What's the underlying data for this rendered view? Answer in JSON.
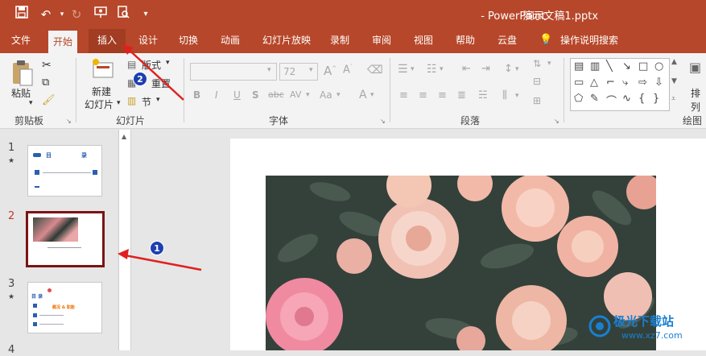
{
  "title": {
    "file": "演示文稿1.pptx",
    "sep": "-",
    "app": "PowerPoint"
  },
  "quick_access": [
    "save-icon",
    "undo-icon",
    "redo-icon",
    "present-icon",
    "print-preview-icon",
    "customize-icon"
  ],
  "tabs": [
    {
      "label": "文件"
    },
    {
      "label": "开始"
    },
    {
      "label": "插入"
    },
    {
      "label": "设计"
    },
    {
      "label": "切换"
    },
    {
      "label": "动画"
    },
    {
      "label": "幻灯片放映"
    },
    {
      "label": "录制"
    },
    {
      "label": "审阅"
    },
    {
      "label": "视图"
    },
    {
      "label": "帮助"
    },
    {
      "label": "云盘"
    },
    {
      "label": "操作说明搜索"
    }
  ],
  "ribbon": {
    "clipboard": {
      "paste": "粘贴",
      "group": "剪贴板"
    },
    "slides": {
      "new_slide": "新建",
      "new_slide2": "幻灯片",
      "layout": "版式",
      "reset": "重置",
      "section": "节",
      "group": "幻灯片"
    },
    "font": {
      "size": "72",
      "group": "字体",
      "bold": "B",
      "italic": "I",
      "underline": "U",
      "shadow": "S",
      "strike": "abc",
      "spacing": "AV",
      "case": "Aa",
      "color": "A"
    },
    "paragraph": {
      "group": "段落"
    },
    "drawing": {
      "arrange": "排列",
      "group": "绘图"
    }
  },
  "thumbnails": [
    {
      "num": "1",
      "star": "★",
      "title_a": "目",
      "title_b": "录"
    },
    {
      "num": "2",
      "star": ""
    },
    {
      "num": "3",
      "star": "★",
      "heading": "目 录",
      "accent": "概况 & 职能"
    },
    {
      "num": "4",
      "star": ""
    }
  ],
  "badges": {
    "one": "1",
    "two": "2"
  },
  "watermark": {
    "line1": "极光下载站",
    "line2": "www.xz7.com"
  },
  "colors": {
    "accent": "#b7472a",
    "selected_border": "#7a1414",
    "annotation": "#e02020",
    "badge": "#1d3fb0"
  }
}
